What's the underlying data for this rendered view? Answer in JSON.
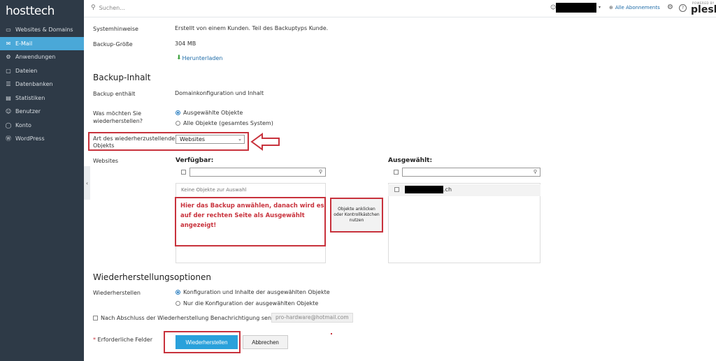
{
  "brand": {
    "logo": "hosttech"
  },
  "sidebar": {
    "items": [
      {
        "icon": "monitor-icon",
        "glyph": "▭",
        "label": "Websites & Domains"
      },
      {
        "icon": "mail-icon",
        "glyph": "✉",
        "label": "E-Mail"
      },
      {
        "icon": "gear-icon",
        "glyph": "⚙",
        "label": "Anwendungen"
      },
      {
        "icon": "folder-icon",
        "glyph": "▢",
        "label": "Dateien"
      },
      {
        "icon": "database-icon",
        "glyph": "☰",
        "label": "Datenbanken"
      },
      {
        "icon": "chart-icon",
        "glyph": "▤",
        "label": "Statistiken"
      },
      {
        "icon": "user-icon",
        "glyph": "☺",
        "label": "Benutzer"
      },
      {
        "icon": "account-icon",
        "glyph": "◯",
        "label": "Konto"
      },
      {
        "icon": "wordpress-icon",
        "glyph": "Ⓦ",
        "label": "WordPress"
      }
    ],
    "collapse_glyph": "‹"
  },
  "topbar": {
    "search_placeholder": "Suchen...",
    "subscriptions_label": "Alle Abonnements",
    "powered_by": "POWERED BY",
    "plesk": "plesk"
  },
  "details": {
    "system_label": "Systemhinweise",
    "system_value": "Erstellt von einem Kunden. Teil des Backuptyps Kunde.",
    "size_label": "Backup-Größe",
    "size_value": "304 MB",
    "download_link": "Herunterladen"
  },
  "backup_content": {
    "heading": "Backup-Inhalt",
    "contains_label": "Backup enthält",
    "contains_value": "Domainkonfiguration und Inhalt",
    "restore_what_label_1": "Was möchten Sie",
    "restore_what_label_2": "wiederherstellen?",
    "option_selected": "Ausgewählte Objekte",
    "option_all": "Alle Objekte (gesamtes System)",
    "type_label_1": "Art des wiederherzustellenden",
    "type_label_2": "Objekts",
    "type_value": "Websites",
    "websites_label": "Websites"
  },
  "panels": {
    "available_title": "Verfügbar:",
    "selected_title": "Ausgewählt:",
    "empty_text": "Keine Objekte zur Auswahl",
    "selected_item_suffix": ".ch"
  },
  "annotations": {
    "main_text": "Hier das Backup anwählen, danach wird es auf der rechten Seite als Ausgewählt angezeigt!",
    "note_text": "Objekte anklicken oder Kontrollkästchen nutzen"
  },
  "restore_options": {
    "heading": "Wiederherstellungsoptionen",
    "restore_label": "Wiederherstellen",
    "option_config_content": "Konfiguration und Inhalte der ausgewählten Objekte",
    "option_config_only": "Nur die Konfiguration der ausgewählten Objekte",
    "notify_label": "Nach Abschluss der Wiederherstellung Benachrichtigung senden an",
    "notify_email": "pro-hardware@hotmail.com",
    "required_star": "*",
    "required_label": "Erforderliche Felder",
    "restore_button": "Wiederherstellen",
    "cancel_button": "Abbrechen"
  },
  "colors": {
    "sidebar_bg": "#2e3a47",
    "active": "#4aa8d8",
    "annotation": "#c8323c",
    "primary": "#2aa1db"
  }
}
